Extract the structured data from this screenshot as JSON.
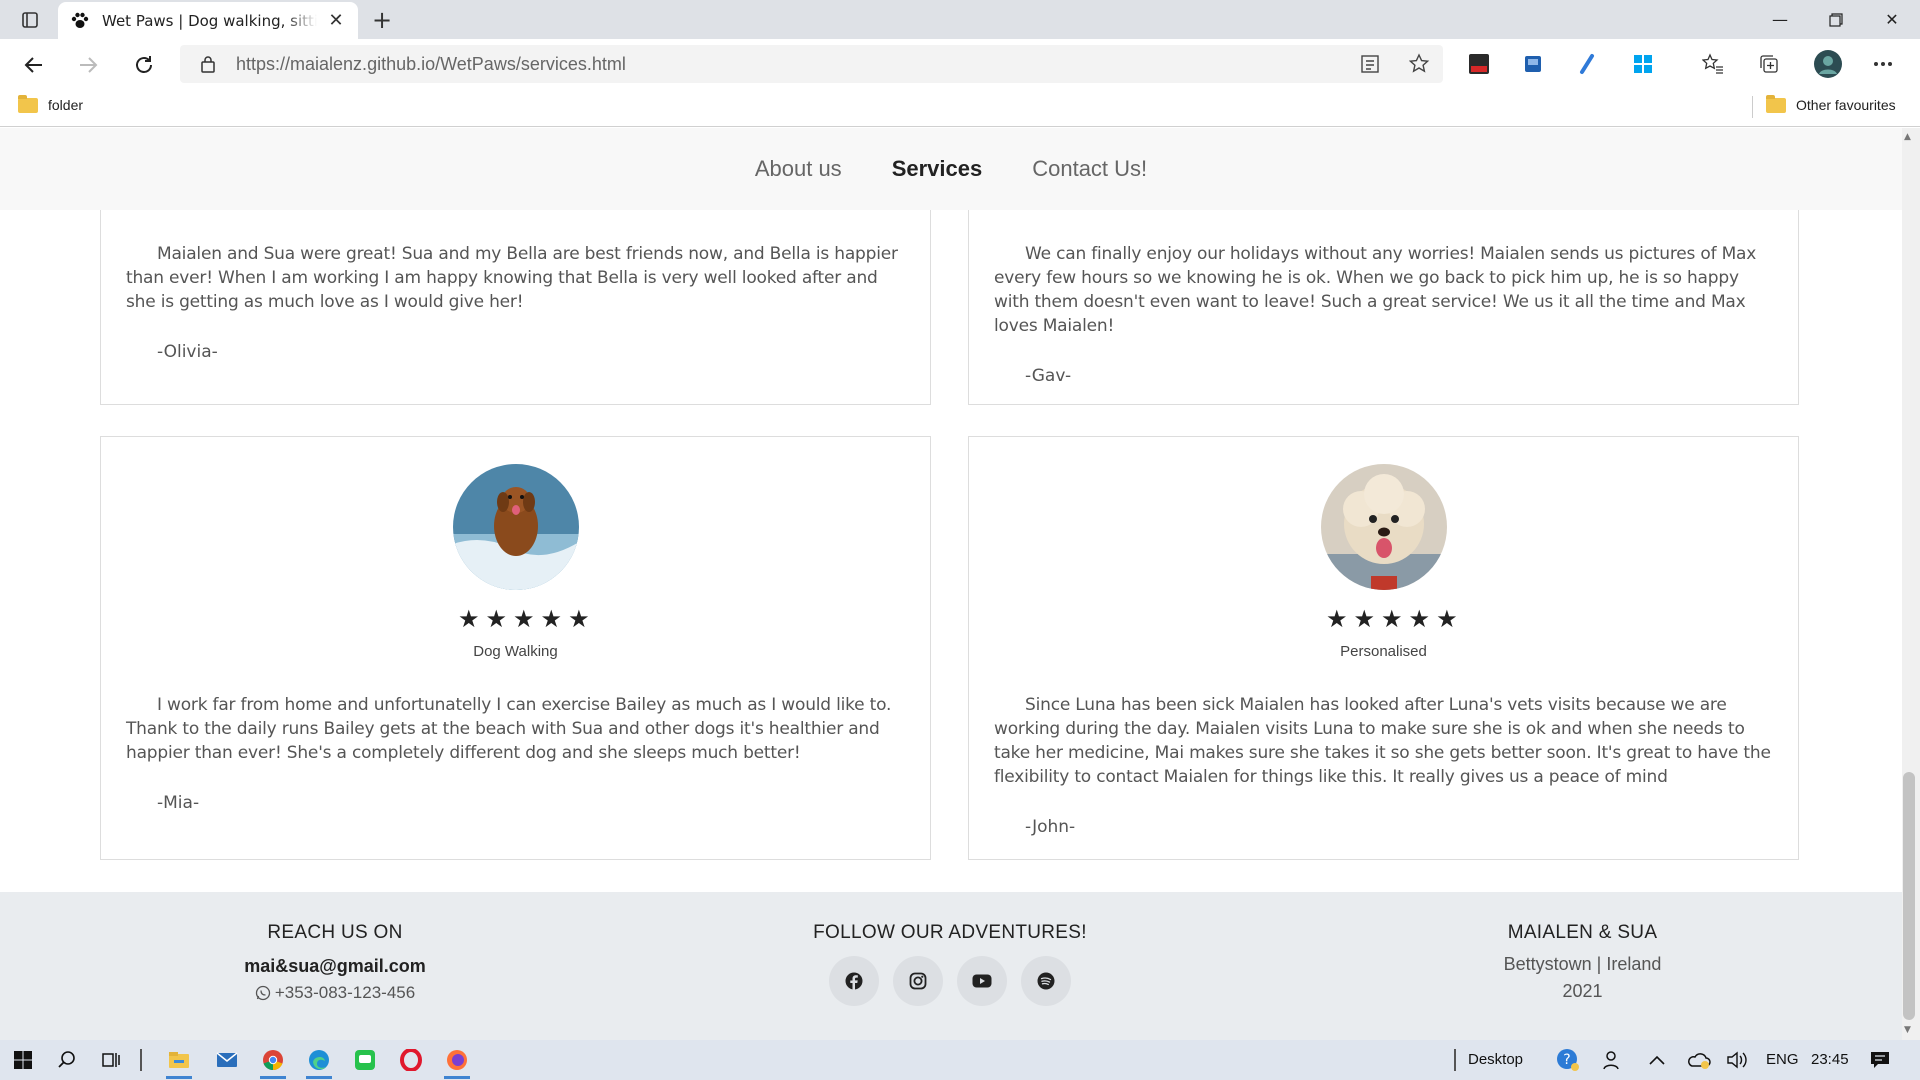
{
  "browser": {
    "tab_title": "Wet Paws | Dog walking, sitting and grooming",
    "url_host": "https://maialenz.github.io",
    "url_path": "/WetPaws/services.html",
    "bookmark_folder": "folder",
    "other_favourites": "Other favourites"
  },
  "nav": {
    "about": "About us",
    "services": "Services",
    "contact": "Contact Us!"
  },
  "reviews": [
    {
      "text": "Maialen and Sua were great! Sua and my Bella are best friends now, and Bella is happier than ever! When I am working I am happy knowing that Bella is very well looked after and she is getting as much love as I would give her!",
      "author": "-Olivia-"
    },
    {
      "text": "We can finally enjoy our holidays without any worries! Maialen sends us pictures of Max every few hours so we knowing he is ok. When we go back to pick him up, he is so happy with them doesn't even want to leave! Such a great service! We us it all the time and Max loves Maialen!",
      "author": "-Gav-"
    },
    {
      "service": "Dog Walking",
      "stars": 5,
      "text": "I work far from home and unfortunatelly I can exercise Bailey as much as I would like to. Thank to the daily runs Bailey gets at the beach with Sua and other dogs it's healthier and happier than ever! She's a completely different dog and she sleeps much better!",
      "author": "-Mia-"
    },
    {
      "service": "Personalised",
      "stars": 5,
      "text": "Since Luna has been sick Maialen has looked after Luna's vets visits because we are working during the day. Maialen visits Luna to make sure she is ok and when she needs to take her medicine, Mai makes sure she takes it so she gets better soon. It's great to have the flexibility to contact Maialen for things like this. It really gives us a peace of mind",
      "author": "-John-"
    }
  ],
  "footer": {
    "reach_title": "REACH US ON",
    "email": "mai&sua@gmail.com",
    "phone": "+353-083-123-456",
    "follow_title": "FOLLOW OUR ADVENTURES!",
    "brand_title": "MAIALEN & SUA",
    "location": "Bettystown | Ireland",
    "year": "2021"
  },
  "taskbar": {
    "desktop": "Desktop",
    "lang": "ENG",
    "time": "23:45"
  },
  "icons": [
    "paw-icon",
    "close-icon",
    "plus-icon",
    "back-icon",
    "forward-icon",
    "refresh-icon",
    "lock-icon",
    "star-icon",
    "facebook-icon",
    "instagram-icon",
    "youtube-icon",
    "spotify-icon",
    "whatsapp-icon",
    "windows-icon",
    "search-icon"
  ]
}
